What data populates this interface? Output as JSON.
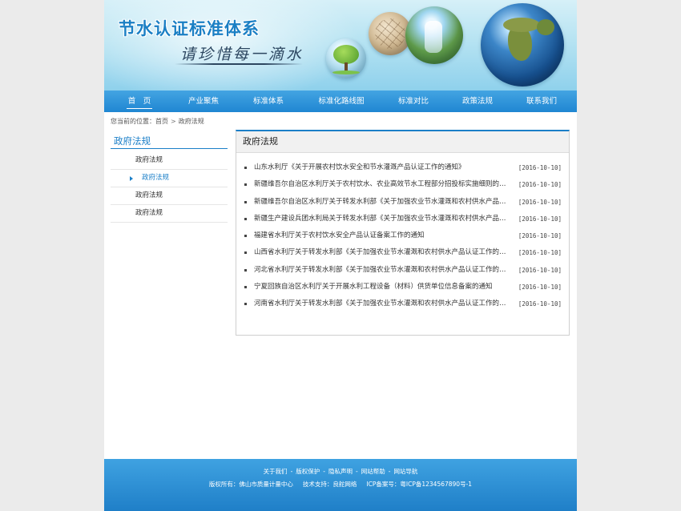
{
  "header": {
    "site_title": "节水认证标准体系",
    "slogan": "请珍惜每一滴水"
  },
  "nav": {
    "items": [
      {
        "label": "首　页",
        "active": true
      },
      {
        "label": "产业聚焦"
      },
      {
        "label": "标准体系"
      },
      {
        "label": "标准化路线图"
      },
      {
        "label": "标准对比"
      },
      {
        "label": "政策法规"
      },
      {
        "label": "联系我们"
      }
    ]
  },
  "breadcrumb": {
    "prefix": "您当前的位置：",
    "home": "首页",
    "current": "政府法规"
  },
  "sidebar": {
    "title": "政府法规",
    "items": [
      {
        "label": "政府法规"
      },
      {
        "label": "政府法规",
        "active": true
      },
      {
        "label": "政府法规"
      },
      {
        "label": "政府法规"
      }
    ]
  },
  "main": {
    "title": "政府法规",
    "articles": [
      {
        "title": "山东水利厅《关于开展农村饮水安全和节水灌溉产品认证工作的通知》",
        "date": "[2016-10-10]"
      },
      {
        "title": "新疆维吾尔自治区水利厅关于农村饮水、农业高效节水工程部分招投标实施细则的补充通知",
        "date": "[2016-10-10]"
      },
      {
        "title": "新疆维吾尔自治区水利厅关于转发水利部《关于加强农业节水灌溉和农村供水产品认证工作的通知》",
        "date": "[2016-10-10]"
      },
      {
        "title": "新疆生产建设兵团水利局关于转发水利部《关于加强农业节水灌溉和农村供水产品认证工作的通知》",
        "date": "[2016-10-10]"
      },
      {
        "title": "福建省水利厅关于农村饮水安全产品认证备案工作的通知",
        "date": "[2016-10-10]"
      },
      {
        "title": "山西省水利厅关于转发水利部《关于加强农业节水灌溉和农村供水产品认证工作的通知》",
        "date": "[2016-10-10]"
      },
      {
        "title": "河北省水利厅关于转发水利部《关于加强农业节水灌溉和农村供水产品认证工作的通知》",
        "date": "[2016-10-10]"
      },
      {
        "title": "宁夏回族自治区水利厅关于开展水利工程设备（材料）供货单位信息备案的通知",
        "date": "[2016-10-10]"
      },
      {
        "title": "河南省水利厅关于转发水利部《关于加强农业节水灌溉和农村供水产品认证工作的通知》",
        "date": "[2016-10-10]"
      }
    ]
  },
  "footer": {
    "links": [
      "关于我们",
      "版权保护",
      "隐私声明",
      "网站帮助",
      "网站导航"
    ],
    "link_sep": "-",
    "copyright": "版权所有：佛山市质量计量中心",
    "support": "技术支持：良舵网络",
    "icp": "ICP备案号：粤ICP备1234567890号-1"
  }
}
